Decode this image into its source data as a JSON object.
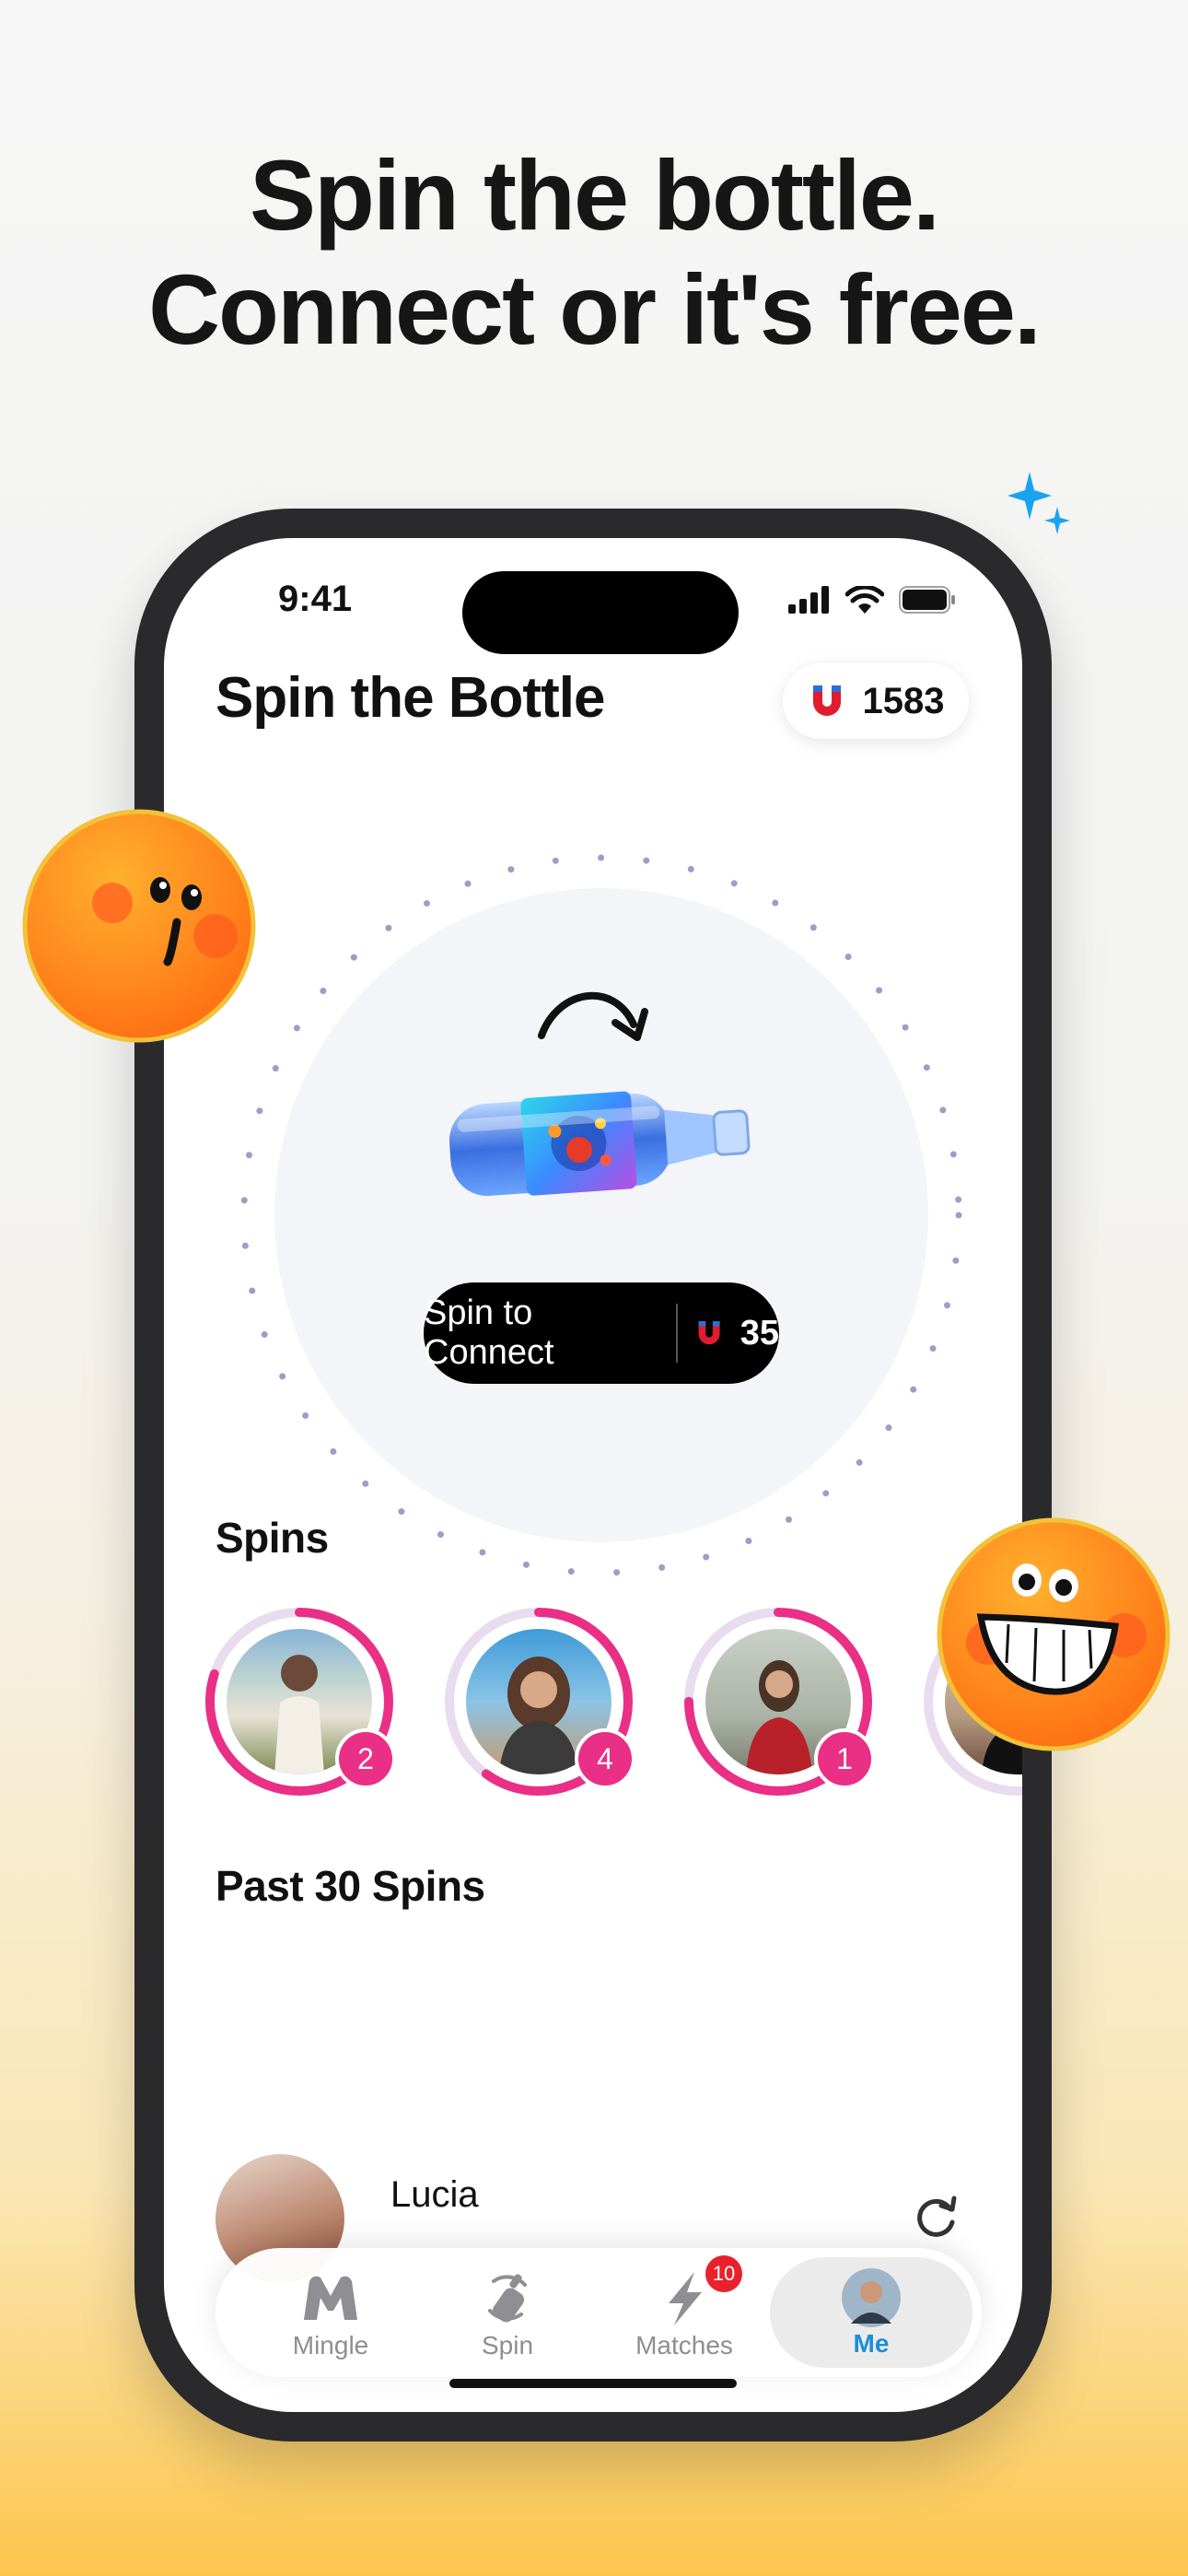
{
  "headline": {
    "line1": "Spin the bottle.",
    "line2": "Connect or it's free."
  },
  "status_bar": {
    "time": "9:41"
  },
  "header": {
    "title": "Spin the Bottle",
    "coin_balance": "1583"
  },
  "spin": {
    "button_label": "Spin to Connect",
    "cost": "35"
  },
  "spins_section": {
    "title": "Spins",
    "items": [
      {
        "count": "2",
        "progress": 0.8
      },
      {
        "count": "4",
        "progress": 0.6
      },
      {
        "count": "1",
        "progress": 0.75
      },
      {
        "count": "",
        "progress": 0.3
      }
    ]
  },
  "past_section": {
    "title": "Past 30 Spins",
    "items": [
      {
        "name": "Lucia"
      }
    ]
  },
  "tabbar": {
    "tabs": [
      {
        "label": "Mingle"
      },
      {
        "label": "Spin"
      },
      {
        "label": "Matches",
        "badge": "10"
      },
      {
        "label": "Me"
      }
    ]
  },
  "colors": {
    "accent_pink": "#ea2f86",
    "active_tab": "#1a8fd6",
    "badge_red": "#e8212b",
    "emoji_orange": "#ff8a1f"
  }
}
